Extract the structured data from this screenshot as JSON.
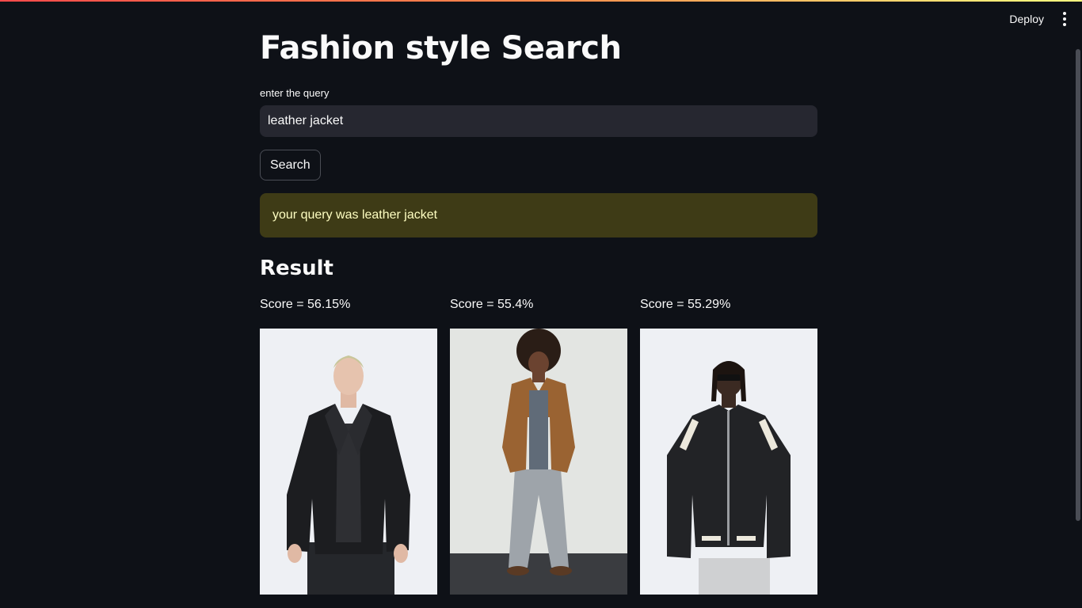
{
  "header": {
    "deploy_label": "Deploy",
    "menu_icon": "vertical-dots-icon"
  },
  "app": {
    "title": "Fashion style Search",
    "query_label": "enter the query",
    "query_value": "leather jacket",
    "search_button": "Search",
    "alert_text": "your query was leather jacket",
    "result_heading": "Result"
  },
  "results": [
    {
      "score_label": "Score = 56.15%",
      "image": "man-black-leather-biker-jacket"
    },
    {
      "score_label": "Score = 55.4%",
      "image": "woman-brown-suede-jacket-jeans"
    },
    {
      "score_label": "Score = 55.29%",
      "image": "man-black-leather-bomber-white-stripes"
    }
  ],
  "colors": {
    "background": "#0e1117",
    "input_bg": "#262730",
    "alert_bg": "#3e3b16",
    "alert_text": "#ffffc2",
    "accent_gradient_start": "#ff4b4b",
    "accent_gradient_end": "#fffd80"
  }
}
